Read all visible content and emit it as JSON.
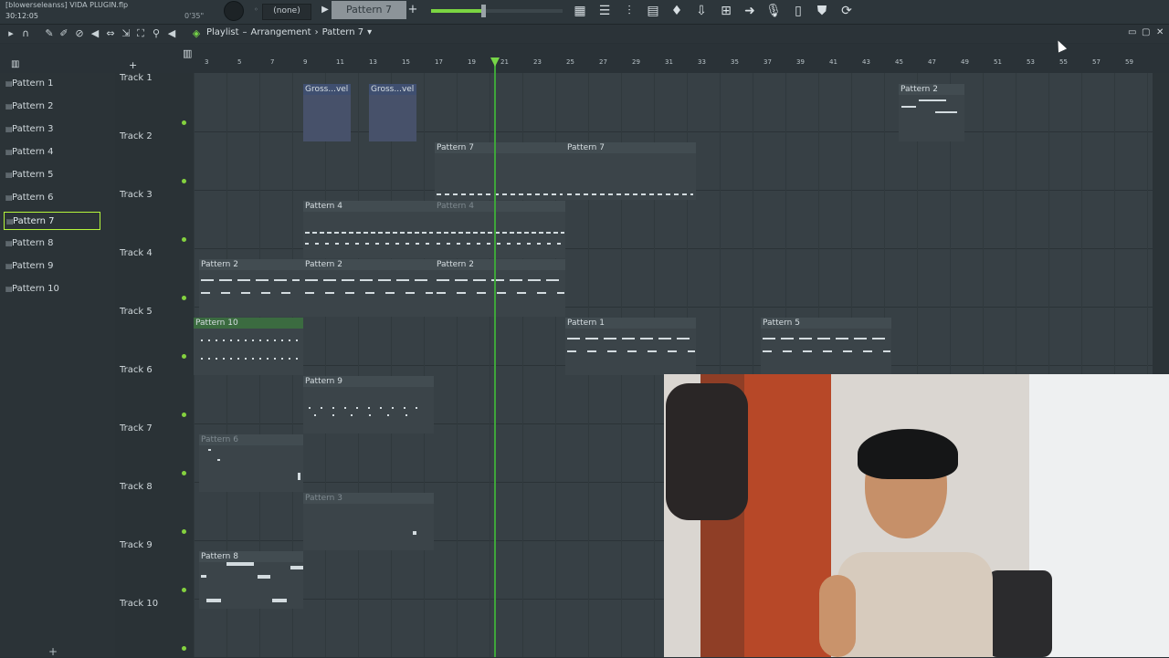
{
  "topbar": {
    "project_name": "[blowerseleanss] VIDA PLUGIN.flp",
    "project_time": "30:12:05",
    "knob_label": "0'35\"",
    "channel_select": "(none)",
    "pattern_selector": "Pattern 7",
    "add_pattern": "+",
    "play_pattern": "▶"
  },
  "toolbar": {
    "breadcrumb_1": "Playlist",
    "breadcrumb_sep": "–",
    "breadcrumb_2": "Arrangement",
    "breadcrumb_arrow": "›",
    "breadcrumb_3": "Pattern 7",
    "breadcrumb_caret": "▾",
    "minimize": "▭",
    "maximize": "▢",
    "close": "✕"
  },
  "ruler": {
    "bars": [
      "3",
      "5",
      "7",
      "9",
      "11",
      "13",
      "15",
      "17",
      "19",
      "21",
      "23",
      "25",
      "27",
      "29",
      "31",
      "33",
      "35",
      "37",
      "39",
      "41",
      "43",
      "45",
      "47",
      "49",
      "51",
      "53",
      "55",
      "57",
      "59"
    ]
  },
  "picker": {
    "items": [
      "Pattern 1",
      "Pattern 2",
      "Pattern 3",
      "Pattern 4",
      "Pattern 5",
      "Pattern 6",
      "Pattern 7",
      "Pattern 8",
      "Pattern 9",
      "Pattern 10"
    ],
    "selected_index": 6,
    "add_label": "+"
  },
  "tracks": [
    "Track 1",
    "Track 2",
    "Track 3",
    "Track 4",
    "Track 5",
    "Track 6",
    "Track 7",
    "Track 8",
    "Track 9",
    "Track 10"
  ],
  "clips": {
    "t1a": "Gross...vel",
    "t1b": "Gross...vel",
    "t1c": "Pattern 2",
    "t2a": "Pattern 7",
    "t2b": "Pattern 7",
    "t3a": "Pattern 4",
    "t3b": "Pattern 4",
    "t4a": "Pattern 2",
    "t4b": "Pattern 2",
    "t4c": "Pattern 2",
    "t5a": "Pattern 10",
    "t5b": "Pattern 1",
    "t5c": "Pattern 5",
    "t6a": "Pattern 9",
    "t7a": "Pattern 6",
    "t8a": "Pattern 3",
    "t9a": "Pattern 8"
  },
  "colors": {
    "accent_green": "#7bd542",
    "selected_border": "#b5f53b",
    "playhead": "#3ea53a"
  }
}
